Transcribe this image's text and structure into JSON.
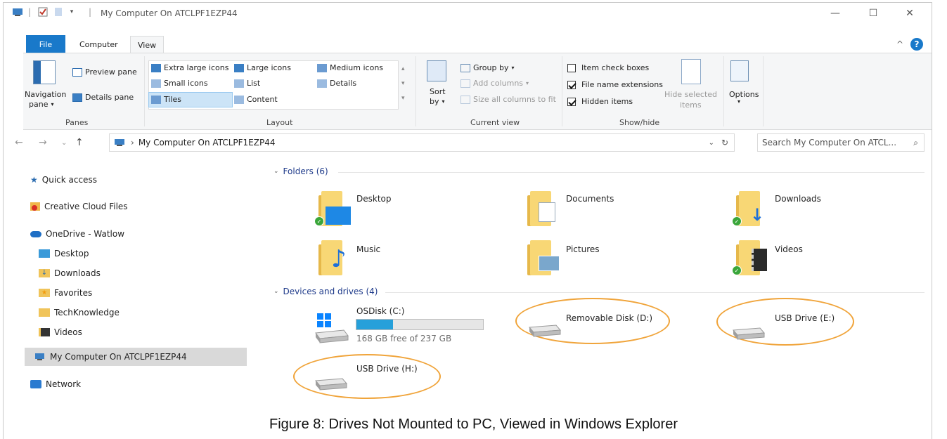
{
  "window": {
    "title": "My Computer On ATCLPF1EZP44",
    "minimize": "—",
    "maximize": "☐",
    "close": "✕"
  },
  "tabs": {
    "file": "File",
    "computer": "Computer",
    "view": "View"
  },
  "ribbon": {
    "panes": {
      "navigation_line1": "Navigation",
      "navigation_line2": "pane",
      "preview": "Preview pane",
      "details": "Details pane",
      "label": "Panes"
    },
    "layout": {
      "extra_large": "Extra large icons",
      "large": "Large icons",
      "medium": "Medium icons",
      "small": "Small icons",
      "list": "List",
      "details": "Details",
      "tiles": "Tiles",
      "content": "Content",
      "label": "Layout",
      "selected": "Tiles"
    },
    "current_view": {
      "sort_line1": "Sort",
      "sort_line2": "by",
      "group_by": "Group by",
      "add_columns": "Add columns",
      "size_all": "Size all columns to fit",
      "label": "Current view"
    },
    "show_hide": {
      "item_check_boxes": "Item check boxes",
      "file_name_extensions": "File name extensions",
      "hidden_items": "Hidden items",
      "hide_selected_line1": "Hide selected",
      "hide_selected_line2": "items",
      "label": "Show/hide",
      "checks": {
        "item_check_boxes": false,
        "file_name_extensions": true,
        "hidden_items": true
      }
    },
    "options": {
      "label": "Options"
    }
  },
  "address": {
    "path": "My Computer On ATCLPF1EZP44",
    "search_placeholder": "Search My Computer On ATCL..."
  },
  "nav": {
    "quick_access": "Quick access",
    "creative_cloud": "Creative Cloud Files",
    "onedrive": "OneDrive - Watlow",
    "desktop": "Desktop",
    "downloads": "Downloads",
    "favorites": "Favorites",
    "techknowledge": "TechKnowledge",
    "videos": "Videos",
    "my_computer": "My Computer On ATCLPF1EZP44",
    "network": "Network"
  },
  "content": {
    "folders_header": "Folders (6)",
    "folders": [
      "Desktop",
      "Documents",
      "Downloads",
      "Music",
      "Pictures",
      "Videos"
    ],
    "devices_header": "Devices and drives (4)",
    "drives": {
      "c_name": "OSDisk (C:)",
      "c_free": "168 GB free of 237 GB",
      "c_used_fraction": 0.29,
      "d_name": "Removable Disk (D:)",
      "e_name": "USB Drive (E:)",
      "h_name": "USB Drive (H:)"
    }
  },
  "caption": "Figure 8: Drives Not Mounted to PC, Viewed in Windows Explorer",
  "colors": {
    "accent": "#1979ca",
    "highlight_ellipse": "#f0a43a",
    "drive_bar": "#26a0da",
    "folder": "#f8d775"
  }
}
